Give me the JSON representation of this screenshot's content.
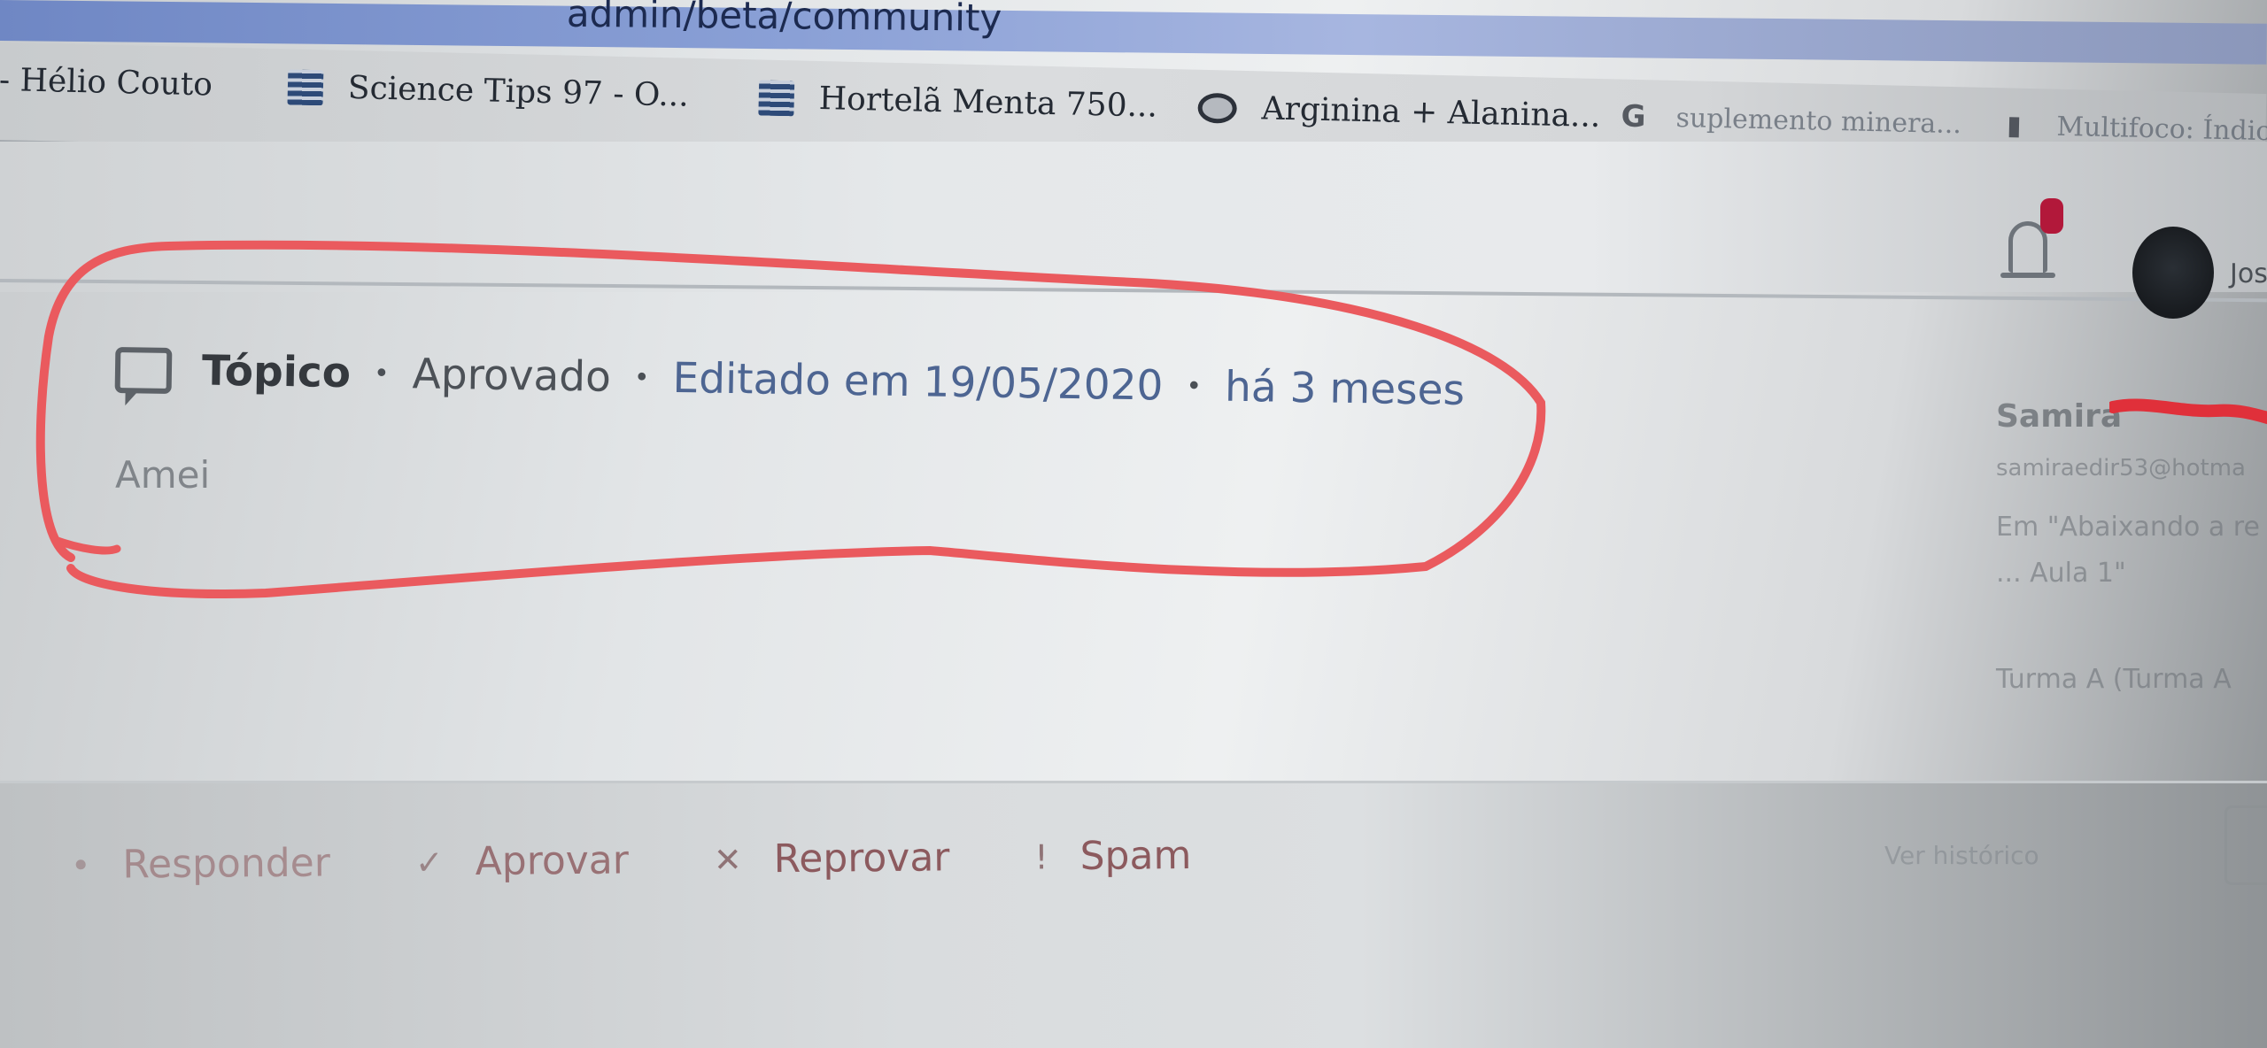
{
  "browser": {
    "url_text": "admin/beta/community",
    "bookmarks": [
      {
        "label": "- Hélio Couto",
        "icon": "none"
      },
      {
        "label": "Science Tips 97 - O...",
        "icon": "grid-favicon"
      },
      {
        "label": "Hortelã Menta 750...",
        "icon": "grid-favicon"
      },
      {
        "label": "Arginina + Alanina...",
        "icon": "globe-favicon"
      },
      {
        "label": "suplemento minera...",
        "icon": "google-favicon"
      },
      {
        "label": "Multifoco: Índice p...",
        "icon": "multifoco-favicon"
      }
    ]
  },
  "header": {
    "notification_icon": "bell-icon",
    "avatar_name": "Jos"
  },
  "post": {
    "type": "Tópico",
    "status": "Aprovado",
    "edited": "Editado em 19/05/2020",
    "time_ago": "há 3 meses",
    "body": "Amei",
    "separator": "•"
  },
  "user_panel": {
    "name": "Samira",
    "email": "samiraedir53@hotma",
    "line1": "Em \"Abaixando a re",
    "line2": "... Aula 1\"",
    "class_label": "Turma A (Turma A"
  },
  "actions": {
    "respond": {
      "label": "Responder",
      "icon": "reply-icon"
    },
    "approve": {
      "label": "Aprovar",
      "icon": "check-icon"
    },
    "reject": {
      "label": "Reprovar",
      "icon": "x-icon"
    },
    "spam": {
      "label": "Spam",
      "icon": "exclamation-icon"
    },
    "history": "Ver histórico"
  },
  "colors": {
    "annotation_red": "#ea5a5e",
    "link_blue": "#4d6592",
    "action_text": "#8c5a5e"
  }
}
